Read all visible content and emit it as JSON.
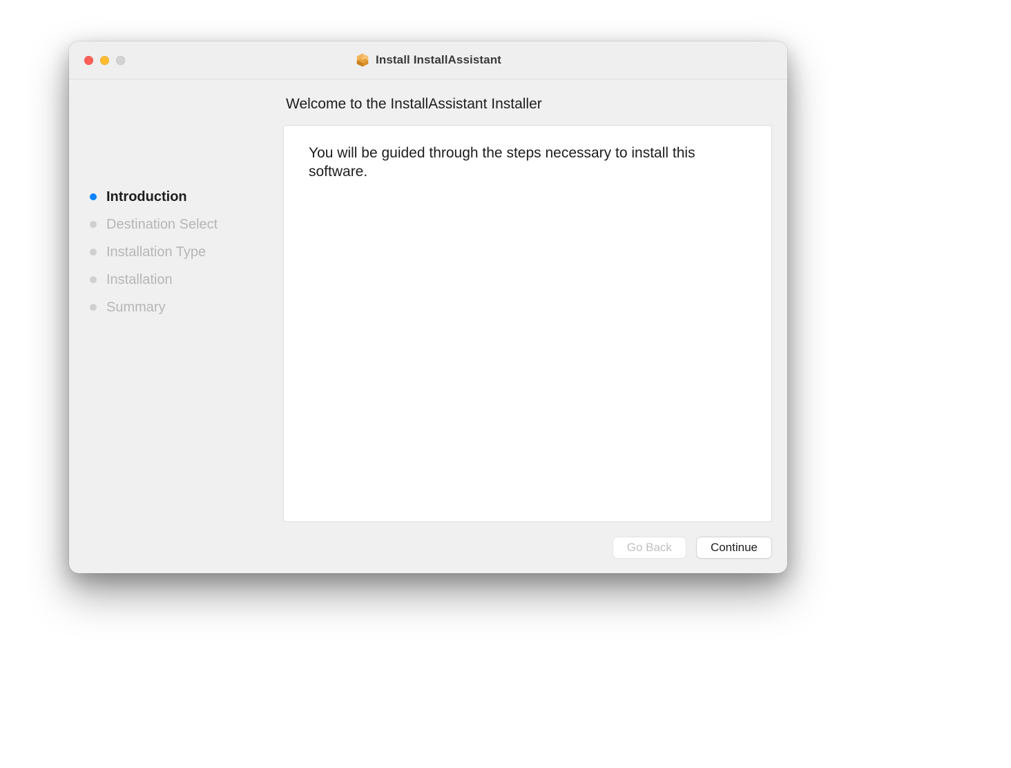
{
  "window": {
    "title": "Install InstallAssistant"
  },
  "heading": "Welcome to the InstallAssistant Installer",
  "body_text": "You will be guided through the steps necessary to install this software.",
  "steps": [
    {
      "label": "Introduction",
      "active": true
    },
    {
      "label": "Destination Select",
      "active": false
    },
    {
      "label": "Installation Type",
      "active": false
    },
    {
      "label": "Installation",
      "active": false
    },
    {
      "label": "Summary",
      "active": false
    }
  ],
  "buttons": {
    "go_back": "Go Back",
    "continue": "Continue"
  }
}
